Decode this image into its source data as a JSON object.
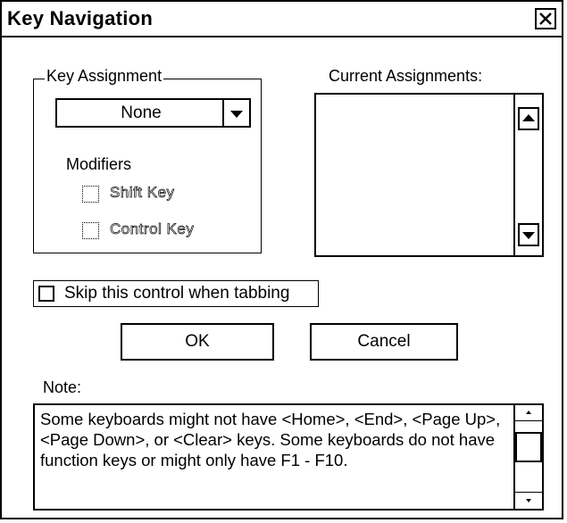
{
  "window": {
    "title": "Key Navigation",
    "close_icon": "close-x-icon"
  },
  "key_assignment": {
    "group_label": "Key Assignment",
    "selected": "None",
    "modifiers_label": "Modifiers",
    "shift_label": "Shift Key",
    "control_label": "Control Key"
  },
  "current_assignments": {
    "label": "Current Assignments:"
  },
  "skip": {
    "label": "Skip this control when tabbing"
  },
  "buttons": {
    "ok": "OK",
    "cancel": "Cancel"
  },
  "note": {
    "label": "Note:",
    "text": "Some keyboards might not have <Home>, <End>, <Page Up>, <Page Down>, or <Clear> keys.  Some keyboards do not have function keys or might only have F1 - F10."
  }
}
